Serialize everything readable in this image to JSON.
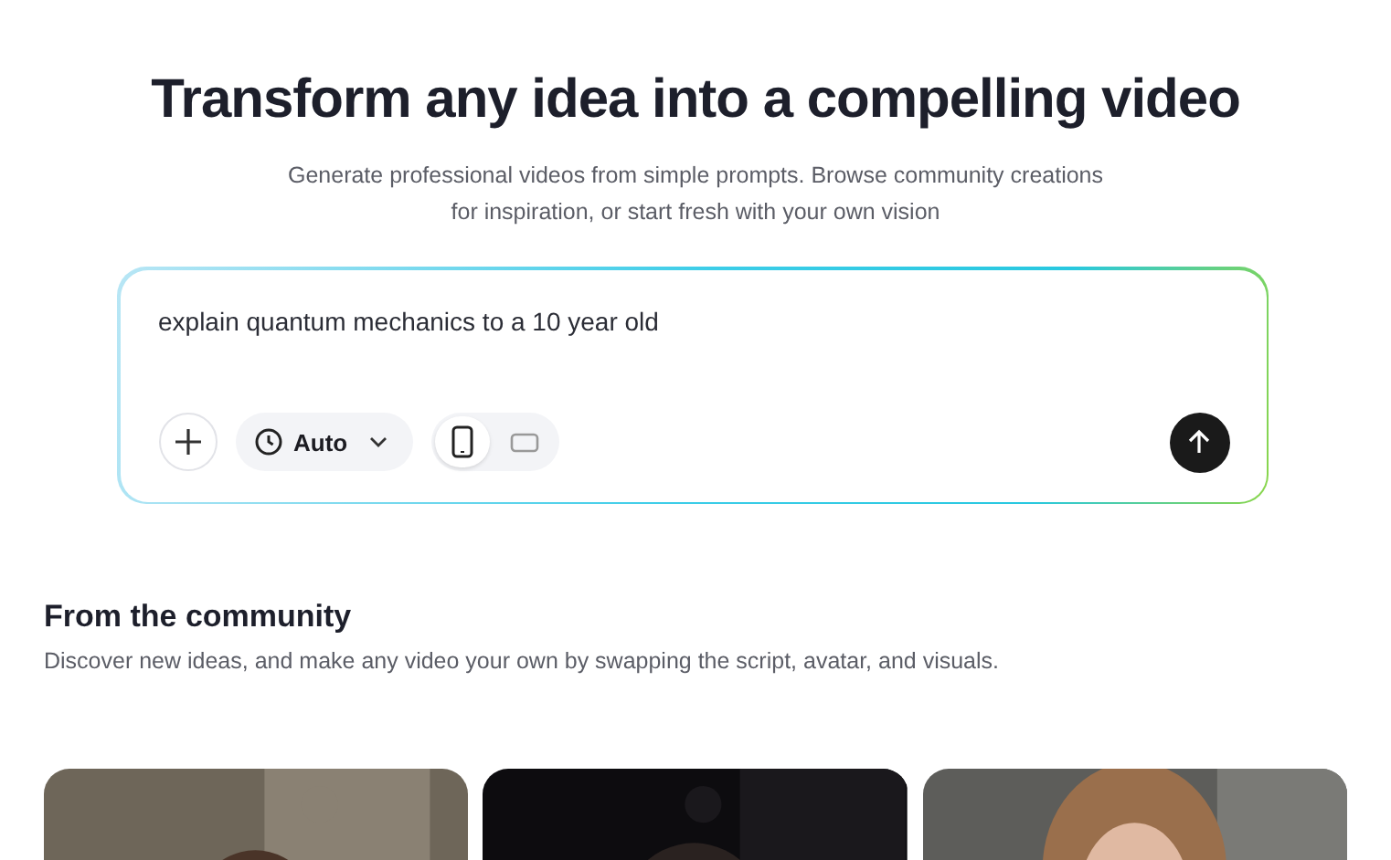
{
  "hero": {
    "title": "Transform any idea into a compelling video",
    "subtitle": "Generate professional videos from simple prompts. Browse community creations for inspiration, or start fresh with your own vision"
  },
  "prompt": {
    "value": "explain quantum mechanics to a 10 year old",
    "duration": "Auto",
    "orientations": [
      {
        "kind": "portrait",
        "selected": true
      },
      {
        "kind": "landscape",
        "selected": false
      }
    ]
  },
  "community": {
    "title": "From the community",
    "description": "Discover new ideas, and make any video your own by swapping the script, avatar, and visuals."
  }
}
